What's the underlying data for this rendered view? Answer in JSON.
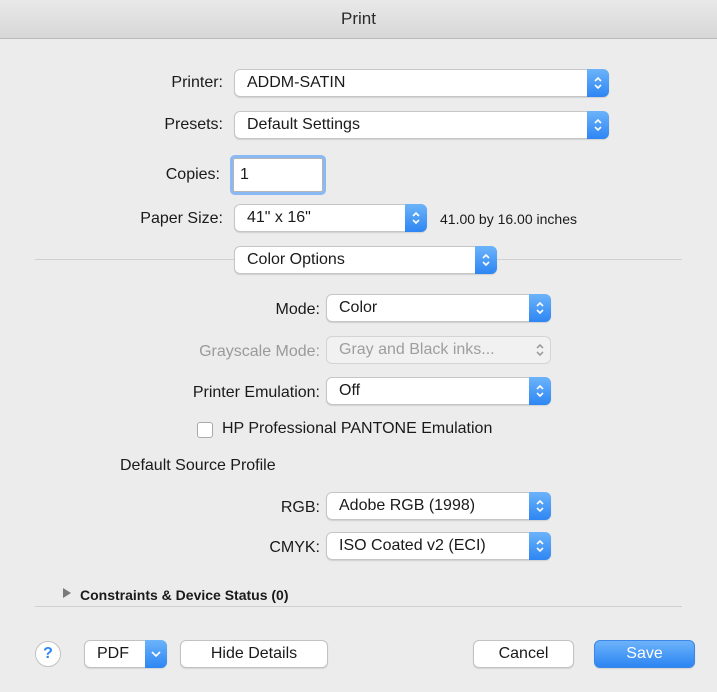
{
  "window": {
    "title": "Print"
  },
  "printer": {
    "label": "Printer:",
    "value": "ADDM-SATIN"
  },
  "presets": {
    "label": "Presets:",
    "value": "Default Settings"
  },
  "copies": {
    "label": "Copies:",
    "value": "1"
  },
  "paper_size": {
    "label": "Paper Size:",
    "value": "41\" x 16\"",
    "dimensions": "41.00 by 16.00 inches"
  },
  "section": {
    "value": "Color Options"
  },
  "color_options": {
    "mode": {
      "label": "Mode:",
      "value": "Color"
    },
    "grayscale_mode": {
      "label": "Grayscale Mode:",
      "value": "Gray and Black inks..."
    },
    "printer_emulation": {
      "label": "Printer Emulation:",
      "value": "Off"
    },
    "pantone_checkbox": {
      "label": "HP Professional PANTONE Emulation",
      "checked": false
    },
    "default_source_profile": {
      "heading": "Default Source Profile"
    },
    "rgb": {
      "label": "RGB:",
      "value": "Adobe RGB (1998)"
    },
    "cmyk": {
      "label": "CMYK:",
      "value": "ISO Coated v2 (ECI)"
    }
  },
  "constraints": {
    "label": "Constraints & Device Status (0)"
  },
  "footer": {
    "help": "?",
    "pdf": "PDF",
    "hide_details": "Hide Details",
    "cancel": "Cancel",
    "save": "Save"
  },
  "colors": {
    "accent": "#2d86f3"
  }
}
